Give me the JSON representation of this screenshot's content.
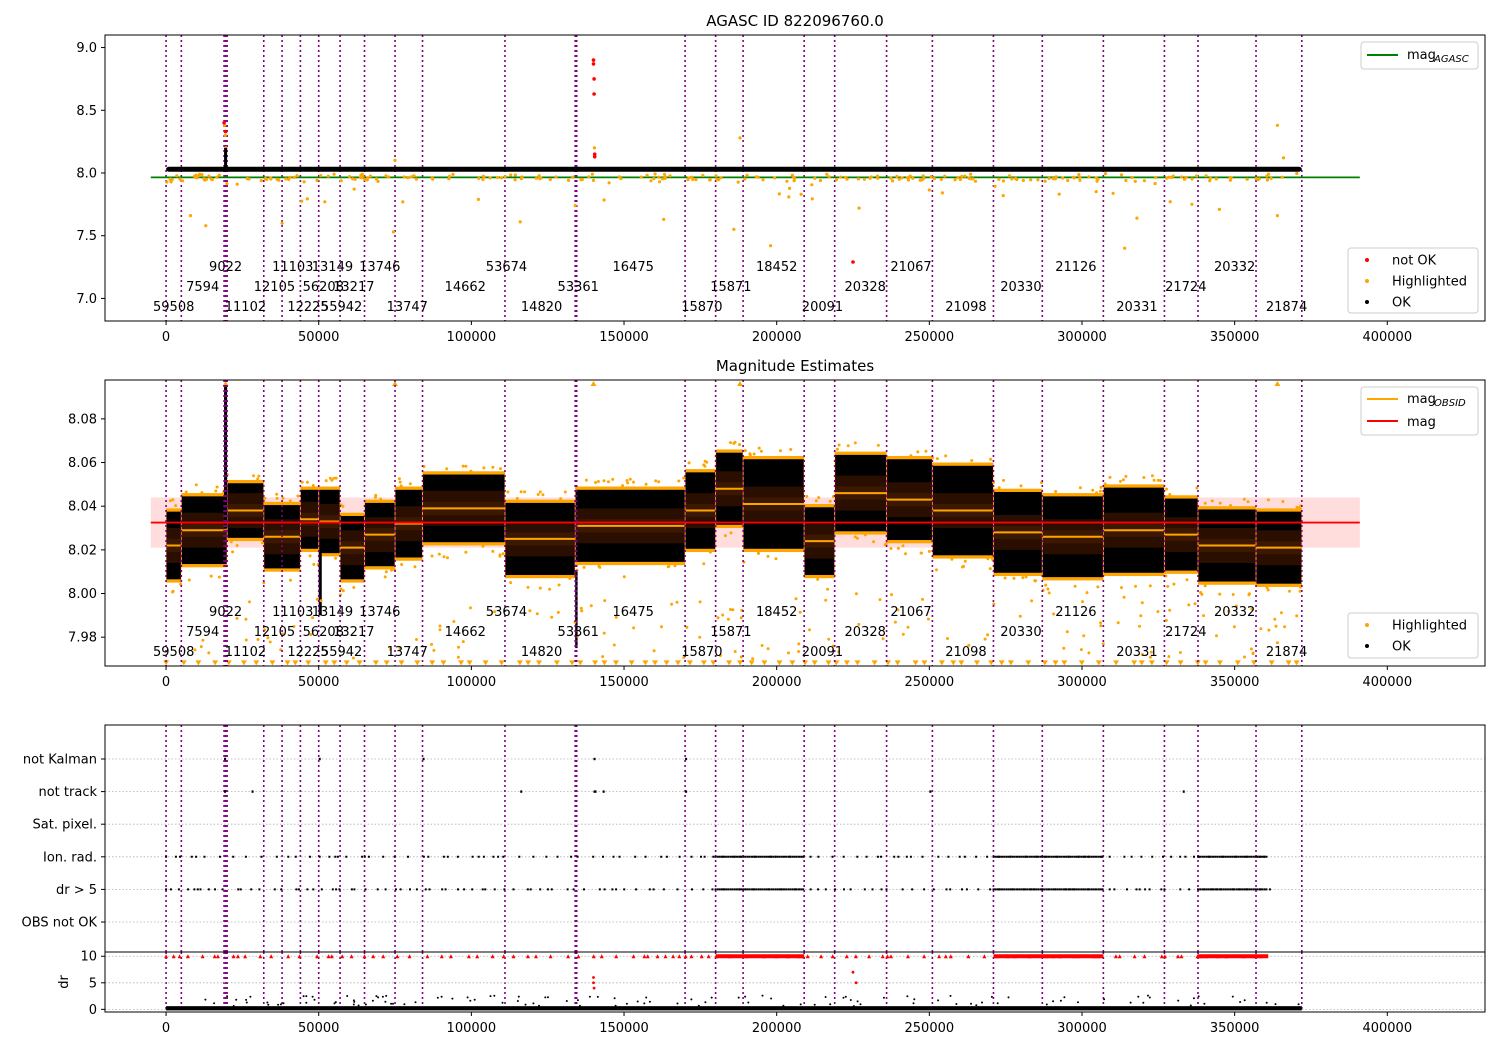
{
  "figure": {
    "panel1_title": "AGASC ID 822096760.0",
    "panel2_title": "Magnitude Estimates"
  },
  "colors": {
    "ok": "#000000",
    "highlighted": "#ffa500",
    "not_ok": "#ff0000",
    "mag_agasc_line": "#008000",
    "mag_line": "#ff0000",
    "mag_obsid_line": "#ffa500",
    "mag_band": "#ffb3b3",
    "obs_boundary": "#800080"
  },
  "chart_data": [
    {
      "type": "scatter",
      "title": "AGASC ID 822096760.0",
      "xlim": [
        -20000,
        432000
      ],
      "ylim": [
        6.82,
        9.1
      ],
      "xticks": [
        0,
        50000,
        100000,
        150000,
        200000,
        250000,
        300000,
        350000,
        400000
      ],
      "xtick_labels": [
        "0",
        "50000",
        "100000",
        "150000",
        "200000",
        "250000",
        "300000",
        "350000",
        "400000"
      ],
      "yticks": [
        7.0,
        7.5,
        8.0,
        8.5,
        9.0
      ],
      "ytick_labels": [
        "7.0",
        "7.5",
        "8.0",
        "8.5",
        "9.0"
      ],
      "lines": [
        {
          "name": "mag_AGASC",
          "label": "mag",
          "subscript": "AGASC",
          "y": 7.965,
          "x": [
            -5000,
            391000
          ]
        }
      ],
      "legend_lines": [
        {
          "label": "mag",
          "subscript": "AGASC"
        }
      ],
      "legend_points": [
        "not OK",
        "Highlighted",
        "OK"
      ],
      "ok_band": {
        "x_start": 0,
        "x_end": 372000,
        "center": 8.03,
        "half_width": 0.02
      },
      "not_ok_points": [
        [
          19000,
          8.4
        ],
        [
          19500,
          8.33
        ],
        [
          140000,
          8.9
        ],
        [
          140000,
          8.87
        ],
        [
          140200,
          8.75
        ],
        [
          140200,
          8.63
        ],
        [
          140400,
          8.15
        ],
        [
          140400,
          8.13
        ],
        [
          225000,
          7.29
        ]
      ],
      "highlighted_spikes": [
        [
          19200,
          8.38
        ],
        [
          19400,
          8.3
        ],
        [
          19600,
          8.2
        ],
        [
          75000,
          8.1
        ],
        [
          140000,
          8.9
        ],
        [
          140300,
          8.2
        ],
        [
          188000,
          8.28
        ],
        [
          364000,
          8.38
        ],
        [
          366000,
          8.12
        ],
        [
          8000,
          7.66
        ],
        [
          13000,
          7.58
        ],
        [
          38000,
          7.6
        ],
        [
          52000,
          7.77
        ],
        [
          116000,
          7.61
        ],
        [
          134000,
          7.74
        ],
        [
          163000,
          7.63
        ],
        [
          186000,
          7.55
        ],
        [
          198000,
          7.42
        ],
        [
          208000,
          7.83
        ],
        [
          314000,
          7.4
        ],
        [
          318000,
          7.64
        ],
        [
          336000,
          7.75
        ],
        [
          345000,
          7.71
        ],
        [
          364000,
          7.66
        ],
        [
          74500,
          7.53
        ],
        [
          227000,
          7.72
        ]
      ],
      "observations": [
        {
          "label": "59508",
          "x": 2500,
          "row": 2
        },
        {
          "label": "7594",
          "x": 12000,
          "row": 1
        },
        {
          "label": "9022",
          "x": 19500,
          "row": 0
        },
        {
          "label": "11102",
          "x": 26000,
          "row": 2
        },
        {
          "label": "12105",
          "x": 35500,
          "row": 1
        },
        {
          "label": "11103",
          "x": 41500,
          "row": 0
        },
        {
          "label": "12225",
          "x": 46500,
          "row": 2
        },
        {
          "label": "56208",
          "x": 51500,
          "row": 1
        },
        {
          "label": "13149",
          "x": 54500,
          "row": 0
        },
        {
          "label": "55942",
          "x": 57500,
          "row": 2
        },
        {
          "label": "13217",
          "x": 61500,
          "row": 1
        },
        {
          "label": "13746",
          "x": 70000,
          "row": 0
        },
        {
          "label": "13747",
          "x": 79000,
          "row": 2
        },
        {
          "label": "14662",
          "x": 98000,
          "row": 1
        },
        {
          "label": "53674",
          "x": 111500,
          "row": 0
        },
        {
          "label": "14820",
          "x": 123000,
          "row": 2
        },
        {
          "label": "53361",
          "x": 135000,
          "row": 1
        },
        {
          "label": "16475",
          "x": 153000,
          "row": 0
        },
        {
          "label": "15870",
          "x": 175500,
          "row": 2
        },
        {
          "label": "15871",
          "x": 185000,
          "row": 1
        },
        {
          "label": "18452",
          "x": 200000,
          "row": 0
        },
        {
          "label": "20091",
          "x": 215000,
          "row": 2
        },
        {
          "label": "20328",
          "x": 229000,
          "row": 1
        },
        {
          "label": "21067",
          "x": 244000,
          "row": 0
        },
        {
          "label": "21098",
          "x": 262000,
          "row": 2
        },
        {
          "label": "20330",
          "x": 280000,
          "row": 1
        },
        {
          "label": "21126",
          "x": 298000,
          "row": 0
        },
        {
          "label": "20331",
          "x": 318000,
          "row": 2
        },
        {
          "label": "21724",
          "x": 334000,
          "row": 1
        },
        {
          "label": "20332",
          "x": 350000,
          "row": 0
        },
        {
          "label": "21874",
          "x": 367000,
          "row": 2
        }
      ],
      "boundaries": [
        0,
        5000,
        19000,
        19500,
        20000,
        32000,
        38000,
        44000,
        50000,
        57000,
        65000,
        75000,
        84000,
        111000,
        134000,
        134500,
        170000,
        180000,
        189000,
        209000,
        219000,
        236000,
        251000,
        271000,
        287000,
        307000,
        327000,
        338000,
        357000,
        372000
      ]
    },
    {
      "type": "scatter",
      "title": "Magnitude Estimates",
      "xlim": [
        -20000,
        432000
      ],
      "ylim": [
        7.9668,
        8.0978
      ],
      "xticks": [
        0,
        50000,
        100000,
        150000,
        200000,
        250000,
        300000,
        350000,
        400000
      ],
      "xtick_labels": [
        "0",
        "50000",
        "100000",
        "150000",
        "200000",
        "250000",
        "300000",
        "350000",
        "400000"
      ],
      "yticks": [
        7.98,
        8.0,
        8.02,
        8.04,
        8.06,
        8.08
      ],
      "ytick_labels": [
        "7.98",
        "8.00",
        "8.02",
        "8.04",
        "8.06",
        "8.08"
      ],
      "lines": [
        {
          "name": "mag",
          "label": "mag",
          "y": 8.0325,
          "x": [
            -5000,
            391000
          ]
        }
      ],
      "legend_lines": [
        {
          "label": "mag",
          "subscript": "OBSID"
        },
        {
          "label": "mag"
        }
      ],
      "legend_points": [
        "Highlighted",
        "OK"
      ],
      "mag_band": {
        "low": 8.021,
        "high": 8.044,
        "x": [
          -5000,
          391000
        ]
      },
      "segments": [
        {
          "x0": 0,
          "x1": 5000,
          "mag": 8.022,
          "spread": 0.017
        },
        {
          "x0": 5000,
          "x1": 20000,
          "mag": 8.029,
          "spread": 0.017
        },
        {
          "x0": 20000,
          "x1": 32000,
          "mag": 8.038,
          "spread": 0.014
        },
        {
          "x0": 32000,
          "x1": 44000,
          "mag": 8.026,
          "spread": 0.016
        },
        {
          "x0": 44000,
          "x1": 50000,
          "mag": 8.034,
          "spread": 0.015
        },
        {
          "x0": 50000,
          "x1": 57000,
          "mag": 8.033,
          "spread": 0.016
        },
        {
          "x0": 57000,
          "x1": 65000,
          "mag": 8.021,
          "spread": 0.016
        },
        {
          "x0": 65000,
          "x1": 75000,
          "mag": 8.027,
          "spread": 0.016
        },
        {
          "x0": 75000,
          "x1": 84000,
          "mag": 8.032,
          "spread": 0.017
        },
        {
          "x0": 84000,
          "x1": 111000,
          "mag": 8.039,
          "spread": 0.017
        },
        {
          "x0": 111000,
          "x1": 134000,
          "mag": 8.025,
          "spread": 0.018
        },
        {
          "x0": 134000,
          "x1": 170000,
          "mag": 8.031,
          "spread": 0.018
        },
        {
          "x0": 170000,
          "x1": 180000,
          "mag": 8.038,
          "spread": 0.019
        },
        {
          "x0": 180000,
          "x1": 189000,
          "mag": 8.048,
          "spread": 0.018
        },
        {
          "x0": 189000,
          "x1": 209000,
          "mag": 8.041,
          "spread": 0.022
        },
        {
          "x0": 209000,
          "x1": 219000,
          "mag": 8.024,
          "spread": 0.017
        },
        {
          "x0": 219000,
          "x1": 236000,
          "mag": 8.046,
          "spread": 0.019
        },
        {
          "x0": 236000,
          "x1": 251000,
          "mag": 8.043,
          "spread": 0.02
        },
        {
          "x0": 251000,
          "x1": 271000,
          "mag": 8.038,
          "spread": 0.022
        },
        {
          "x0": 271000,
          "x1": 287000,
          "mag": 8.028,
          "spread": 0.02
        },
        {
          "x0": 287000,
          "x1": 307000,
          "mag": 8.026,
          "spread": 0.02
        },
        {
          "x0": 307000,
          "x1": 327000,
          "mag": 8.029,
          "spread": 0.021
        },
        {
          "x0": 327000,
          "x1": 338000,
          "mag": 8.027,
          "spread": 0.018
        },
        {
          "x0": 338000,
          "x1": 357000,
          "mag": 8.022,
          "spread": 0.018
        },
        {
          "x0": 357000,
          "x1": 372000,
          "mag": 8.021,
          "spread": 0.018
        }
      ],
      "clipped_markers_y": 7.968,
      "observations_ref": "same as panel 1"
    },
    {
      "type": "scatter",
      "title": "",
      "xlim": [
        -20000,
        432000
      ],
      "xticks": [
        0,
        50000,
        100000,
        150000,
        200000,
        250000,
        300000,
        350000,
        400000
      ],
      "xtick_labels": [
        "0",
        "50000",
        "100000",
        "150000",
        "200000",
        "250000",
        "300000",
        "350000",
        "400000"
      ],
      "flag_rows": [
        "not Kalman",
        "not track",
        "Sat. pixel.",
        "Ion. rad.",
        "dr > 5",
        "OBS not OK"
      ],
      "flag_segments": {
        "not Kalman": [
          [
            140000,
            140400
          ],
          [
            19000,
            19500
          ],
          [
            50000,
            50500
          ],
          [
            84000,
            84300
          ],
          [
            170000,
            170300
          ]
        ],
        "not track": [
          [
            140000,
            141000
          ],
          [
            143000,
            143500
          ],
          [
            28000,
            28500
          ],
          [
            116000,
            116500
          ],
          [
            170000,
            170500
          ],
          [
            250000,
            250500
          ],
          [
            333000,
            333500
          ],
          [
            19000,
            19500
          ]
        ],
        "Sat. pixel.": [],
        "Ion. rad.": [
          [
            180000,
            209000
          ],
          [
            271000,
            307000
          ],
          [
            338000,
            361000
          ]
        ],
        "dr > 5": [
          [
            180000,
            209000
          ],
          [
            271000,
            307000
          ],
          [
            338000,
            361000
          ]
        ],
        "OBS not OK": []
      },
      "dr_ylabel": "dr",
      "dr_yticks": [
        0,
        5,
        10
      ],
      "dr_ytick_labels": [
        "0",
        "5",
        "10"
      ],
      "dr_ylim": [
        -0.5,
        10.8
      ],
      "dr_threshold": 10
    }
  ]
}
